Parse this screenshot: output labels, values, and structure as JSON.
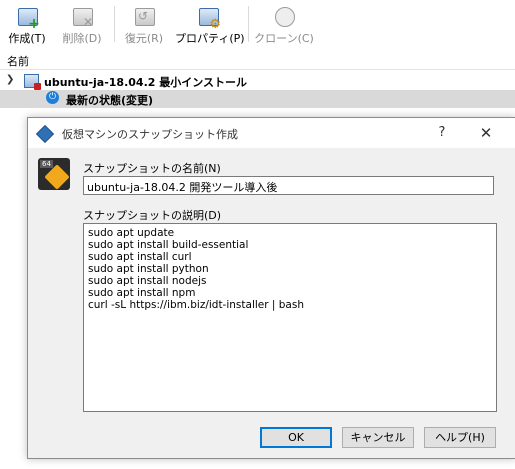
{
  "toolbar": {
    "buttons": [
      {
        "label": "作成(T)",
        "icon": "take-snapshot-icon",
        "enabled": true
      },
      {
        "label": "削除(D)",
        "icon": "delete-snapshot-icon",
        "enabled": false
      },
      {
        "label": "復元(R)",
        "icon": "restore-snapshot-icon",
        "enabled": false
      },
      {
        "label": "プロパティ(P)",
        "icon": "properties-icon",
        "enabled": true
      },
      {
        "label": "クローン(C)",
        "icon": "clone-icon",
        "enabled": false
      }
    ]
  },
  "tree": {
    "header": "名前",
    "vm_name": "ubuntu-ja-18.04.2 最小インストール",
    "current_state": "最新の状態(変更)"
  },
  "dialog": {
    "title": "仮想マシンのスナップショット作成",
    "help_glyph": "?",
    "close_glyph": "✕",
    "name_label": "スナップショットの名前(N)",
    "name_value": "ubuntu-ja-18.04.2 開発ツール導入後",
    "desc_label": "スナップショットの説明(D)",
    "desc_lines": [
      "sudo apt update",
      "sudo apt install build-essential",
      "sudo apt install curl",
      "sudo apt install python",
      "sudo apt install nodejs",
      "sudo apt install npm",
      "curl -sL https://ibm.biz/idt-installer | bash"
    ],
    "buttons": {
      "ok": "OK",
      "cancel": "キャンセル",
      "help": "ヘルプ(H)"
    },
    "snapshot_badge": "64"
  },
  "colors": {
    "selected_row": "#d9d9d9",
    "dialog_bg": "#f0f0f0",
    "accent": "#0078d7"
  }
}
